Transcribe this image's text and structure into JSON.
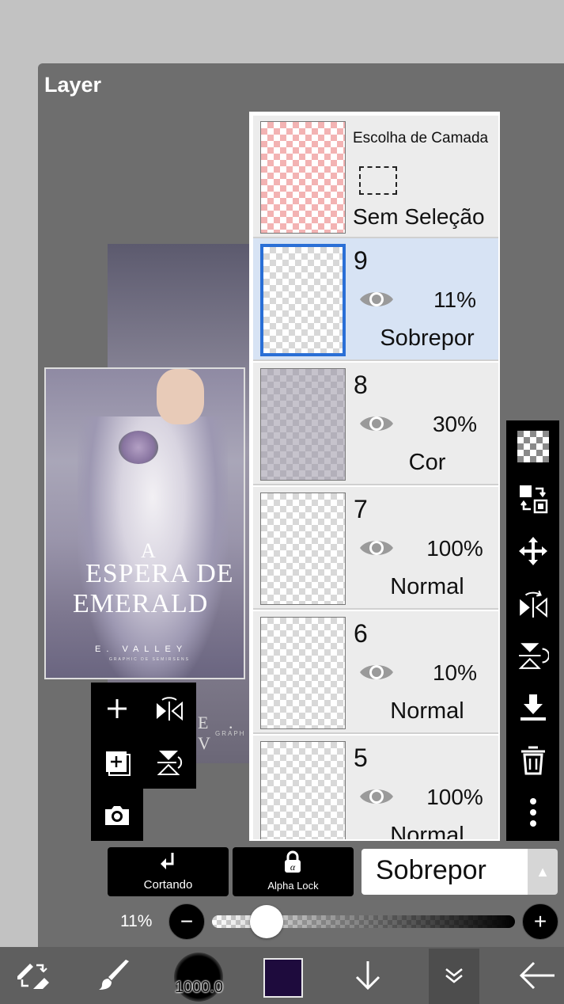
{
  "panel": {
    "title": "Layer"
  },
  "canvas": {
    "cover_title_a": "A",
    "cover_title_line1": "ESPERA DE",
    "cover_title_line2": "EMERALD",
    "cover_author": "E. VALLEY",
    "cover_subtitle": "GRAPHIC DE SEMIRSENS",
    "ghost_author": "E . V",
    "ghost_sub": "GRAPH"
  },
  "selection_layer": {
    "title": "Escolha de Camada",
    "status": "Sem Seleção"
  },
  "layers": [
    {
      "number": "9",
      "opacity": "11%",
      "blend": "Sobrepor",
      "selected": true
    },
    {
      "number": "8",
      "opacity": "30%",
      "blend": "Cor",
      "selected": false
    },
    {
      "number": "7",
      "opacity": "100%",
      "blend": "Normal",
      "selected": false
    },
    {
      "number": "6",
      "opacity": "10%",
      "blend": "Normal",
      "selected": false
    },
    {
      "number": "5",
      "opacity": "100%",
      "blend": "Normal",
      "selected": false
    }
  ],
  "right_toolbar": [
    "checkerboard-icon",
    "transfer-icon",
    "move-icon",
    "flip-horizontal-icon",
    "flip-vertical-icon",
    "merge-down-icon",
    "trash-icon",
    "more-vertical-icon"
  ],
  "tool_grid": [
    "add-layer-icon",
    "flip-horizontal-icon",
    "add-copy-icon",
    "flip-vertical-icon",
    "camera-icon"
  ],
  "controls": {
    "clipping_label": "Cortando",
    "alpha_lock_label": "Alpha Lock",
    "blend_mode": "Sobrepor",
    "opacity_label": "11%",
    "opacity_value": 0.11
  },
  "bottom_bar": {
    "brush_size": "1000.0",
    "color": "#1e0b3d"
  }
}
